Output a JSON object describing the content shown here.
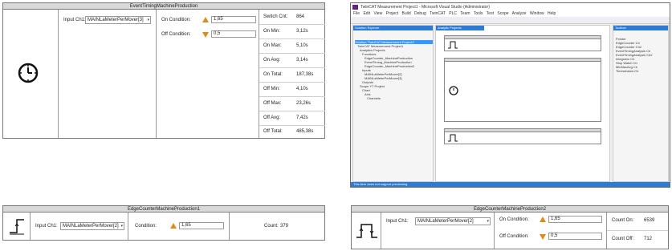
{
  "timing_panel": {
    "title": "EventTimingMachineProduction",
    "input_label": "Input Ch1:",
    "input_value": "MAINLaMeterPerMover[3]",
    "on_condition_label": "On Condition:",
    "on_condition_value": "1,65",
    "off_condition_label": "Off Condition:",
    "off_condition_value": "0,5",
    "stats": [
      {
        "label": "Switch Cnt:",
        "value": "864"
      },
      {
        "label": "On Min:",
        "value": "3,12s"
      },
      {
        "label": "On Max:",
        "value": "5,10s"
      },
      {
        "label": "On Avg:",
        "value": "3,14s"
      },
      {
        "label": "On Total:",
        "value": "187,38s"
      },
      {
        "label": "Off Min:",
        "value": "4,10s"
      },
      {
        "label": "Off Max:",
        "value": "23,26s"
      },
      {
        "label": "Off Avg:",
        "value": "7,42s"
      },
      {
        "label": "Off Total:",
        "value": "485,38s"
      }
    ]
  },
  "edge1_panel": {
    "title": "EdgeCounterMachineProduction1",
    "input_label": "Input Ch1:",
    "input_value": "MAINLaMeterPerMover[2]",
    "condition_label": "Condition:",
    "condition_value": "1,65",
    "count_label": "Count:",
    "count_value": "379"
  },
  "edge2_panel": {
    "title": "EdgeCounterMachineProduction2",
    "input_label": "Input Ch1:",
    "input_value": "MAINLaMeterPerMover[2]",
    "on_condition_label": "On Condition:",
    "on_condition_value": "1,65",
    "off_condition_label": "Off Condition:",
    "off_condition_value": "0,5",
    "count_on_label": "Count On:",
    "count_on_value": "6539",
    "count_off_label": "Count Off:",
    "count_off_value": "712"
  },
  "ide": {
    "title": "TwinCAT Measurement Project1 - Microsoft Visual Studio (Administrator)",
    "menu": "File Edit View Project Build Debug TwinCAT PLC Team Tools Test Scope Analyze Window Help",
    "solution_explorer_title": "Solution Explorer",
    "solution_tree": [
      "Solution 'TwinCAT Measurement Project1'",
      "TwinCAT Measurement Project1",
      "Analytics Projects",
      "Functions",
      "EdgeCounter_MachineProduction",
      "EventTiming_MachineProduction",
      "EdgeCounter_MachineProduction2",
      "Inputs",
      "MAINLaMeterPerMover[2]",
      "MAINLaMeterPerMover[3]",
      "Outputs",
      "Scope YT Project",
      "Chart",
      "Axis",
      "Channels"
    ],
    "editor_tab": "Analytic Projects",
    "toolbox_title": "Toolbox",
    "toolbox_items": [
      "Pointer",
      "EdgeCounter Ch",
      "EdgeCounter Ch2",
      "EventTimingAnalysis Ch",
      "EventTimingAnalysis Ch2",
      "Integrator Ch",
      "Stop Watch Ch",
      "MinMaxAvg Ch",
      "Timewindow Ch"
    ],
    "status": "This item does not support previewing"
  },
  "colors": {
    "accent": "#e08a1e",
    "titlebar": "#d8d8d8",
    "status": "#2c7bd6"
  }
}
